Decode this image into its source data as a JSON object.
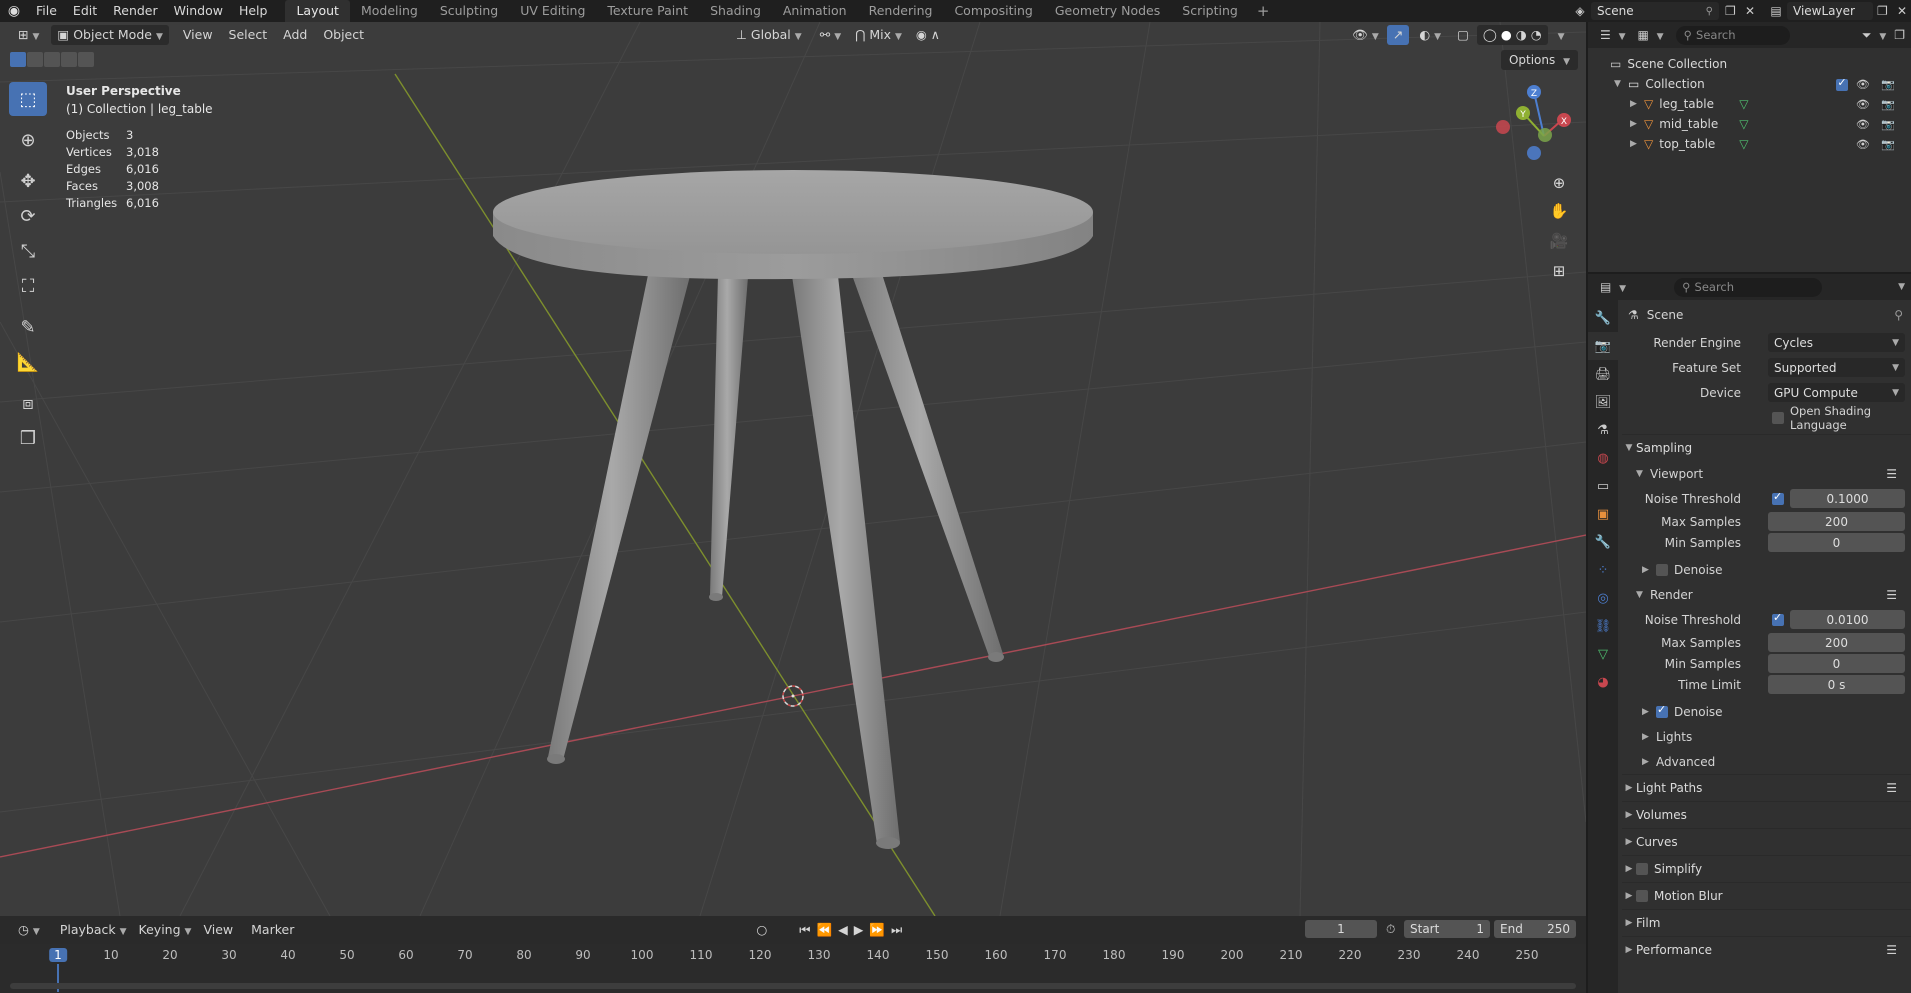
{
  "topbar": {
    "menus": [
      "File",
      "Edit",
      "Render",
      "Window",
      "Help"
    ],
    "workspaces": [
      "Layout",
      "Modeling",
      "Sculpting",
      "UV Editing",
      "Texture Paint",
      "Shading",
      "Animation",
      "Rendering",
      "Compositing",
      "Geometry Nodes",
      "Scripting"
    ],
    "active_workspace": "Layout",
    "scene": "Scene",
    "view_layer": "ViewLayer"
  },
  "viewport": {
    "mode": "Object Mode",
    "menus": [
      "View",
      "Select",
      "Add",
      "Object"
    ],
    "transform_orientation": "Global",
    "snap_mode": "Mix",
    "options_label": "Options",
    "view_name": "User Perspective",
    "collection_info": "(1) Collection | leg_table",
    "stats": [
      {
        "label": "Objects",
        "value": "3"
      },
      {
        "label": "Vertices",
        "value": "3,018"
      },
      {
        "label": "Edges",
        "value": "6,016"
      },
      {
        "label": "Faces",
        "value": "3,008"
      },
      {
        "label": "Triangles",
        "value": "6,016"
      }
    ],
    "gizmo_axes": [
      "X",
      "Y",
      "Z"
    ]
  },
  "timeline": {
    "menus": [
      "Playback",
      "Keying",
      "View",
      "Marker"
    ],
    "current_frame": "1",
    "start_label": "Start",
    "start": "1",
    "end_label": "End",
    "end": "250",
    "ruler_ticks": [
      "1",
      "10",
      "20",
      "30",
      "40",
      "50",
      "60",
      "70",
      "80",
      "90",
      "100",
      "110",
      "120",
      "130",
      "140",
      "150",
      "160",
      "170",
      "180",
      "190",
      "200",
      "210",
      "220",
      "230",
      "240",
      "250"
    ]
  },
  "outliner": {
    "search_placeholder": "Search",
    "root": "Scene Collection",
    "collection": "Collection",
    "objects": [
      "leg_table",
      "mid_table",
      "top_table"
    ]
  },
  "properties": {
    "search_placeholder": "Search",
    "context": "Scene",
    "render_engine_label": "Render Engine",
    "render_engine": "Cycles",
    "feature_set_label": "Feature Set",
    "feature_set": "Supported",
    "device_label": "Device",
    "device": "GPU Compute",
    "osl_label": "Open Shading Language",
    "sampling": {
      "title": "Sampling",
      "viewport": {
        "title": "Viewport",
        "noise_label": "Noise Threshold",
        "noise": "0.1000",
        "max_label": "Max Samples",
        "max": "200",
        "min_label": "Min Samples",
        "min": "0",
        "denoise_label": "Denoise"
      },
      "render": {
        "title": "Render",
        "noise_label": "Noise Threshold",
        "noise": "0.0100",
        "max_label": "Max Samples",
        "max": "200",
        "min_label": "Min Samples",
        "min": "0",
        "time_label": "Time Limit",
        "time": "0 s",
        "denoise_label": "Denoise"
      },
      "lights_label": "Lights",
      "advanced_label": "Advanced"
    },
    "panels": [
      "Light Paths",
      "Volumes",
      "Curves",
      "Simplify",
      "Motion Blur",
      "Film",
      "Performance"
    ]
  },
  "colors": {
    "accent": "#4772b3",
    "viewport_bg": "#3c3c3c",
    "x_axis": "#c8474f",
    "y_axis": "#8fb032",
    "z_axis": "#4d7fd1",
    "object_orange": "#e8903c",
    "mesh_green": "#4fbf6e"
  }
}
